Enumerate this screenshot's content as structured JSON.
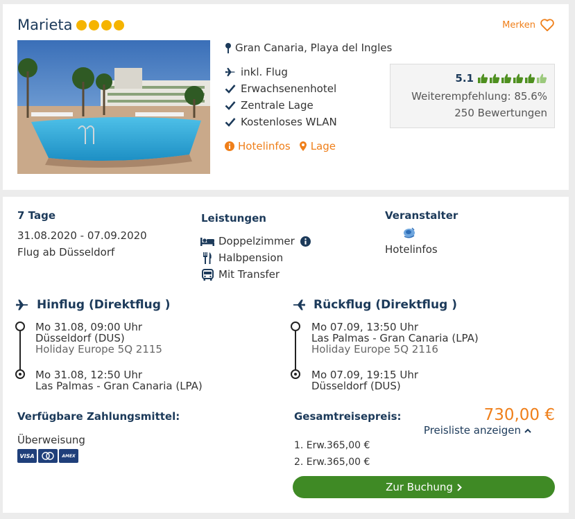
{
  "hotel": {
    "name": "Marieta",
    "stars": 4,
    "save_label": "Merken",
    "location": "Gran Canaria, Playa del Ingles",
    "features": [
      {
        "icon": "plane-icon",
        "label": "inkl. Flug"
      },
      {
        "icon": "check-icon",
        "label": "Erwachsenenhotel"
      },
      {
        "icon": "check-icon",
        "label": "Zentrale Lage"
      },
      {
        "icon": "check-icon",
        "label": "Kostenloses WLAN"
      }
    ],
    "links": {
      "info": "Hotelinfos",
      "location": "Lage"
    },
    "rating": {
      "score": "5.1",
      "thumbs_max": 6,
      "recommendation": "Weiterempfehlung: 85.6%",
      "reviews": "250 Bewertungen"
    }
  },
  "offer": {
    "duration": "7 Tage",
    "dates": "31.08.2020 - 07.09.2020",
    "departure": "Flug ab Düsseldorf",
    "services_title": "Leistungen",
    "services": [
      {
        "icon": "bed-icon",
        "label": "Doppelzimmer"
      },
      {
        "icon": "cutlery-icon",
        "label": "Halbpension"
      },
      {
        "icon": "bus-icon",
        "label": "Mit Transfer"
      }
    ],
    "operator_title": "Veranstalter",
    "operator_link": "Hotelinfos",
    "outbound": {
      "title": "Hinflug (Direktflug )",
      "leg1": {
        "time": "Mo 31.08, 09:00 Uhr",
        "airport": "Düsseldorf (DUS)",
        "flight": "Holiday Europe 5Q 2115"
      },
      "leg2": {
        "time": "Mo 31.08, 12:50 Uhr",
        "airport": "Las Palmas - Gran Canaria (LPA)"
      }
    },
    "return": {
      "title": "Rückflug (Direktflug )",
      "leg1": {
        "time": "Mo 07.09, 13:50 Uhr",
        "airport": "Las Palmas - Gran Canaria (LPA)",
        "flight": "Holiday Europe 5Q 2116"
      },
      "leg2": {
        "time": "Mo 07.09, 19:15 Uhr",
        "airport": "Düsseldorf (DUS)"
      }
    },
    "payment": {
      "title": "Verfügbare Zahlungsmittel:",
      "method": "Überweisung",
      "cards": [
        "VISA",
        "",
        "AMEX"
      ]
    },
    "total": {
      "title": "Gesamtreisepreis:",
      "price": "730,00 €",
      "pricelist_toggle": "Preisliste anzeigen",
      "lines": [
        "1. Erw.365,00 €",
        "2. Erw.365,00 €"
      ]
    },
    "book_label": "Zur Buchung"
  },
  "colors": {
    "accent": "#ef7f1a",
    "navy": "#1c3a5a",
    "cta": "#3f8a25",
    "stars": "#f5b400",
    "thumbs": "#4e8f1f"
  }
}
